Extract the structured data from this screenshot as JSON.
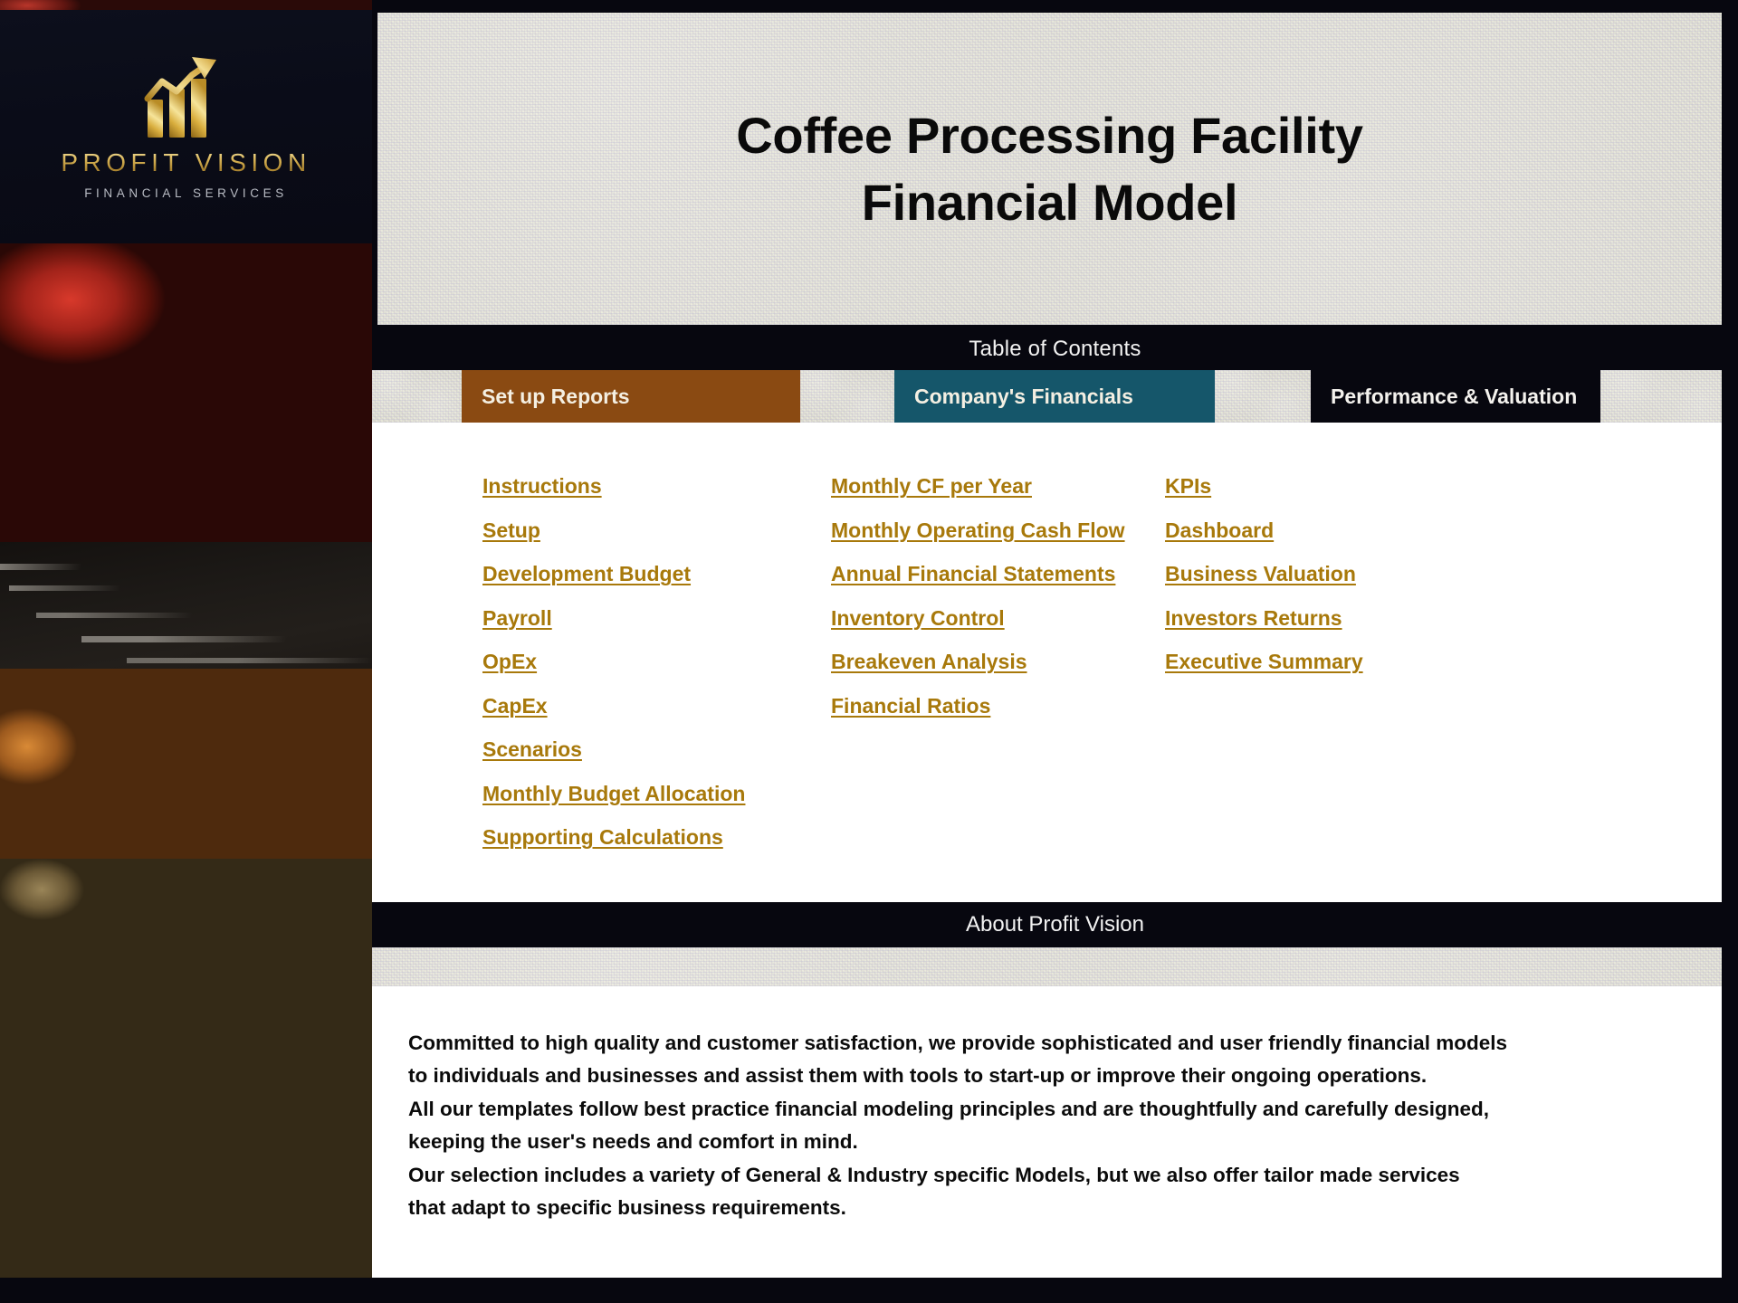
{
  "brand": {
    "name": "PROFIT VISION",
    "tagline": "FINANCIAL SERVICES",
    "logo_icon": "growth-bar-chart-arrow-icon"
  },
  "title": {
    "line1": "Coffee Processing Facility",
    "line2": "Financial Model"
  },
  "toc": {
    "header": "Table of Contents",
    "tabs": [
      {
        "label": "Set up Reports",
        "color": "#8a4a12"
      },
      {
        "label": "Company's Financials",
        "color": "#15566a"
      },
      {
        "label": "Performance & Valuation",
        "color": "#07070f"
      }
    ],
    "columns": [
      {
        "tab": "Set up Reports",
        "links": [
          "Instructions",
          "Setup",
          "Development Budget",
          "Payroll",
          "OpEx",
          "CapEx",
          "Scenarios",
          "Monthly Budget Allocation",
          "Supporting Calculations"
        ]
      },
      {
        "tab": "Company's Financials",
        "links": [
          "Monthly CF per Year",
          "Monthly Operating Cash Flow",
          "Annual Financial Statements",
          "Inventory Control",
          "Breakeven Analysis",
          "Financial Ratios"
        ]
      },
      {
        "tab": "Performance & Valuation",
        "links": [
          "KPIs",
          "Dashboard",
          "Business Valuation",
          "Investors Returns",
          "Executive Summary"
        ]
      }
    ]
  },
  "about": {
    "header": "About Profit Vision",
    "lines": [
      "Committed to high quality and customer satisfaction, we provide sophisticated and user friendly financial models",
      "to individuals and businesses and assist them  with tools to start-up or improve their ongoing operations.",
      "All our templates follow best practice financial modeling principles and are thoughtfully and carefully designed,",
      "keeping the user's needs and comfort in mind.",
      "Our selection includes a variety of General & Industry specific Models, but we also offer tailor made services",
      "that adapt to specific business requirements."
    ]
  },
  "colors": {
    "link": "#a8790b",
    "tab_setup": "#8a4a12",
    "tab_financials": "#15566a",
    "bar_black": "#07070f",
    "paper": "#dfdfd2",
    "gold": "#d8b355"
  },
  "photo": {
    "alt": "coffee-cherries-and-beans-photo"
  }
}
